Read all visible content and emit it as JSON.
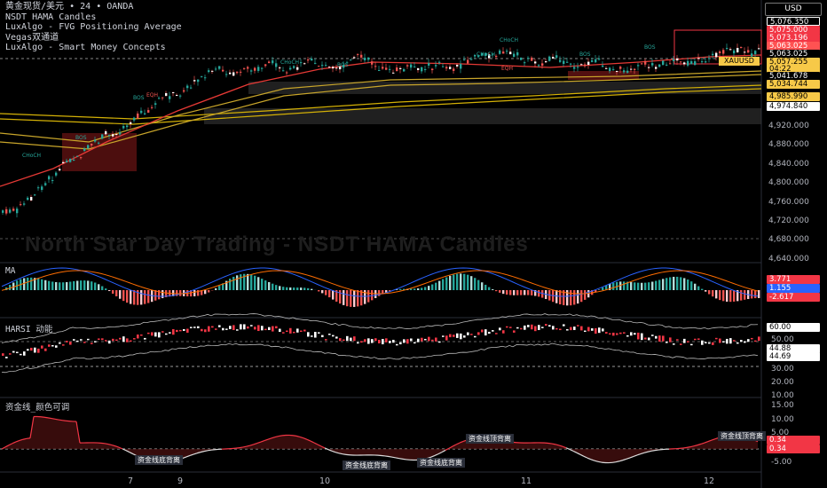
{
  "header": {
    "symbol_line": "黄金现货/美元",
    "sep": "•",
    "interval": "24",
    "broker": "OANDA",
    "indicators": [
      "NSDT HAMA Candles",
      "LuxAlgo - FVG Positioning Average",
      "Vegas双通道",
      "LuxAlgo - Smart Money Concepts"
    ]
  },
  "currency": "USD",
  "watermark": "North Star Day Trading - NSDT HAMA Candles",
  "price_axis": [
    "4,920.000",
    "4,880.000",
    "4,840.000",
    "4,800.000",
    "4,760.000",
    "4,720.000",
    "4,680.000",
    "4,640.000"
  ],
  "price_tags": [
    {
      "text": "5,076.350",
      "bg": "#000000",
      "fg": "#ffffff",
      "border": "#ffffff"
    },
    {
      "text": "5,075.000",
      "bg": "#f23645",
      "fg": "#ffffff"
    },
    {
      "text": "5,073.196",
      "bg": "#f23645",
      "fg": "#ffffff"
    },
    {
      "text": "5,063.025",
      "bg": "#ff5252",
      "fg": "#ffffff"
    },
    {
      "text": "5,063.025",
      "bg": "#000000",
      "fg": "#ffffff"
    },
    {
      "text": "5,057.255",
      "bg": "#f7c948",
      "fg": "#000000"
    },
    {
      "text": "04:22",
      "bg": "#f7c948",
      "fg": "#000000"
    },
    {
      "text": "5,041.678",
      "bg": "#000000",
      "fg": "#ffffff"
    },
    {
      "text": "5,034.744",
      "bg": "#f7c948",
      "fg": "#000000"
    },
    {
      "text": "4,985.990",
      "bg": "#f7c948",
      "fg": "#000000"
    },
    {
      "text": "4,974.840",
      "bg": "#ffffff",
      "fg": "#000000"
    }
  ],
  "symbol_tag": "XAUUSD",
  "macd": {
    "label": "MA",
    "values": [
      "3.771",
      "1.155",
      "-2.617"
    ]
  },
  "harsi": {
    "label": "HARSI",
    "label2": "动能",
    "axis": [
      "60.00",
      "50.00",
      "44.88",
      "44.69",
      "30.00",
      "20.00",
      "10.00"
    ]
  },
  "money_line": {
    "label": "资金线_颜色可调",
    "axis": [
      "15.00",
      "10.00",
      "5.00",
      "0.34",
      "0.34",
      "-5.00"
    ],
    "divergence_tags": [
      "资金线顶背离",
      "资金线底背离",
      "资金线底背离",
      "资金线底背离",
      "资金线顶背离"
    ]
  },
  "smc_labels": [
    "CHoCH",
    "BOS",
    "BOS",
    "EQH",
    "CHoCH",
    "BOS",
    "CHoCH",
    "EQH",
    "BOS",
    "BOS",
    "CHoCH"
  ],
  "x_axis": [
    "7",
    "9",
    "10",
    "11",
    "12"
  ]
}
